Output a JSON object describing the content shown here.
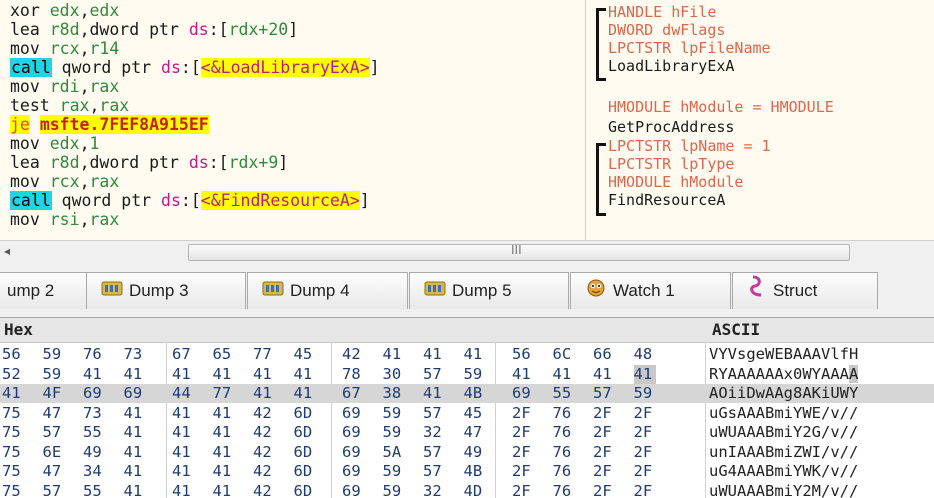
{
  "disassembly": {
    "lines": [
      {
        "parts": [
          {
            "t": "xor ",
            "c": "op"
          },
          {
            "t": "edx",
            "c": "reg"
          },
          {
            "t": ",",
            "c": "op"
          },
          {
            "t": "edx",
            "c": "reg"
          }
        ]
      },
      {
        "parts": [
          {
            "t": "lea ",
            "c": "op"
          },
          {
            "t": "r8d",
            "c": "reg"
          },
          {
            "t": ",dword ptr ",
            "c": "op"
          },
          {
            "t": "ds",
            "c": "seg"
          },
          {
            "t": ":[",
            "c": "op"
          },
          {
            "t": "rdx+20",
            "c": "num"
          },
          {
            "t": "]",
            "c": "op"
          }
        ]
      },
      {
        "parts": [
          {
            "t": "mov ",
            "c": "op"
          },
          {
            "t": "rcx",
            "c": "reg"
          },
          {
            "t": ",",
            "c": "op"
          },
          {
            "t": "r14",
            "c": "reg"
          }
        ]
      },
      {
        "parts": [
          {
            "t": "call",
            "c": "hl-call"
          },
          {
            "t": " qword ptr ",
            "c": "op"
          },
          {
            "t": "ds",
            "c": "seg"
          },
          {
            "t": ":[",
            "c": "op"
          },
          {
            "t": "<&LoadLibraryExA>",
            "c": "sym"
          },
          {
            "t": "]",
            "c": "op"
          }
        ]
      },
      {
        "parts": [
          {
            "t": "mov ",
            "c": "op"
          },
          {
            "t": "rdi",
            "c": "reg"
          },
          {
            "t": ",",
            "c": "op"
          },
          {
            "t": "rax",
            "c": "reg"
          }
        ]
      },
      {
        "parts": [
          {
            "t": "test ",
            "c": "op"
          },
          {
            "t": "rax",
            "c": "reg"
          },
          {
            "t": ",",
            "c": "op"
          },
          {
            "t": "rax",
            "c": "reg"
          }
        ]
      },
      {
        "parts": [
          {
            "t": "je",
            "c": "hl-je"
          },
          {
            "t": " ",
            "c": "op"
          },
          {
            "t": "msfte.7FEF8A915EF",
            "c": "jmptgt-hl"
          }
        ]
      },
      {
        "parts": [
          {
            "t": "mov ",
            "c": "op"
          },
          {
            "t": "edx",
            "c": "reg"
          },
          {
            "t": ",",
            "c": "op"
          },
          {
            "t": "1",
            "c": "num"
          }
        ]
      },
      {
        "parts": [
          {
            "t": "lea ",
            "c": "op"
          },
          {
            "t": "r8d",
            "c": "reg"
          },
          {
            "t": ",dword ptr ",
            "c": "op"
          },
          {
            "t": "ds",
            "c": "seg"
          },
          {
            "t": ":[",
            "c": "op"
          },
          {
            "t": "rdx+9",
            "c": "num"
          },
          {
            "t": "]",
            "c": "op"
          }
        ]
      },
      {
        "parts": [
          {
            "t": "mov ",
            "c": "op"
          },
          {
            "t": "rcx",
            "c": "reg"
          },
          {
            "t": ",",
            "c": "op"
          },
          {
            "t": "rax",
            "c": "reg"
          }
        ]
      },
      {
        "parts": [
          {
            "t": "call",
            "c": "hl-call"
          },
          {
            "t": " qword ptr ",
            "c": "op"
          },
          {
            "t": "ds",
            "c": "seg"
          },
          {
            "t": ":[",
            "c": "op"
          },
          {
            "t": "<&FindResourceA>",
            "c": "sym"
          },
          {
            "t": "]",
            "c": "op"
          }
        ]
      },
      {
        "parts": [
          {
            "t": "mov ",
            "c": "op"
          },
          {
            "t": "rsi",
            "c": "reg"
          },
          {
            "t": ",",
            "c": "op"
          },
          {
            "t": "rax",
            "c": "reg"
          }
        ]
      }
    ],
    "comments": [
      {
        "text": "HANDLE hFile",
        "c": "carg"
      },
      {
        "text": "DWORD dwFlags",
        "c": "carg"
      },
      {
        "text": "LPCTSTR lpFileName",
        "c": "carg"
      },
      {
        "text": "LoadLibraryExA",
        "c": "cfn"
      },
      {
        "text": "HMODULE hModule = HMODULE",
        "c": "cmod"
      },
      {
        "text": "GetProcAddress",
        "c": "cfn"
      },
      {
        "text": "LPCTSTR lpName = 1",
        "c": "carg"
      },
      {
        "text": "LPCTSTR lpType",
        "c": "carg"
      },
      {
        "text": "HMODULE hModule",
        "c": "carg"
      },
      {
        "text": "FindResourceA",
        "c": "cfn"
      }
    ]
  },
  "scrollbar": {
    "left_arrow": "◂",
    "grip": "III"
  },
  "tabs": [
    {
      "label": "ump 2",
      "icon": ""
    },
    {
      "label": "Dump 3",
      "icon": "dump-icon"
    },
    {
      "label": "Dump 4",
      "icon": "dump-icon"
    },
    {
      "label": "Dump 5",
      "icon": "dump-icon"
    },
    {
      "label": "Watch 1",
      "icon": "watch-icon"
    },
    {
      "label": "Struct",
      "icon": "struct-icon"
    }
  ],
  "dump": {
    "hex_header": "Hex",
    "ascii_header": "ASCII",
    "rows": [
      {
        "bytes": [
          "56",
          "59",
          "76",
          "73",
          "67",
          "65",
          "77",
          "45",
          "42",
          "41",
          "41",
          "41",
          "56",
          "6C",
          "66",
          "48"
        ],
        "ascii": "VYVsgeWEBAAAVlfH",
        "selected": false
      },
      {
        "bytes": [
          "52",
          "59",
          "41",
          "41",
          "41",
          "41",
          "41",
          "41",
          "78",
          "30",
          "57",
          "59",
          "41",
          "41",
          "41",
          "41"
        ],
        "ascii": "RYAAAAAAx0WYAAAA",
        "selected": false,
        "hl_last": true
      },
      {
        "bytes": [
          "41",
          "4F",
          "69",
          "69",
          "44",
          "77",
          "41",
          "41",
          "67",
          "38",
          "41",
          "4B",
          "69",
          "55",
          "57",
          "59"
        ],
        "ascii": "AOiiDwAAg8AKiUWY",
        "selected": true
      },
      {
        "bytes": [
          "75",
          "47",
          "73",
          "41",
          "41",
          "41",
          "42",
          "6D",
          "69",
          "59",
          "57",
          "45",
          "2F",
          "76",
          "2F",
          "2F"
        ],
        "ascii": "uGsAAABmiYWE/v//",
        "selected": false
      },
      {
        "bytes": [
          "75",
          "57",
          "55",
          "41",
          "41",
          "41",
          "42",
          "6D",
          "69",
          "59",
          "32",
          "47",
          "2F",
          "76",
          "2F",
          "2F"
        ],
        "ascii": "uWUAAABmiY2G/v//",
        "selected": false
      },
      {
        "bytes": [
          "75",
          "6E",
          "49",
          "41",
          "41",
          "41",
          "42",
          "6D",
          "69",
          "5A",
          "57",
          "49",
          "2F",
          "76",
          "2F",
          "2F"
        ],
        "ascii": "unIAAABmiZWI/v//",
        "selected": false
      },
      {
        "bytes": [
          "75",
          "47",
          "34",
          "41",
          "41",
          "41",
          "42",
          "6D",
          "69",
          "59",
          "57",
          "4B",
          "2F",
          "76",
          "2F",
          "2F"
        ],
        "ascii": "uG4AAABmiYWK/v//",
        "selected": false
      },
      {
        "bytes": [
          "75",
          "57",
          "55",
          "41",
          "41",
          "41",
          "42",
          "6D",
          "69",
          "59",
          "32",
          "4D",
          "2F",
          "76",
          "2F",
          "2F"
        ],
        "ascii": "uWUAAABmiY2M/v//",
        "selected": false
      }
    ]
  }
}
